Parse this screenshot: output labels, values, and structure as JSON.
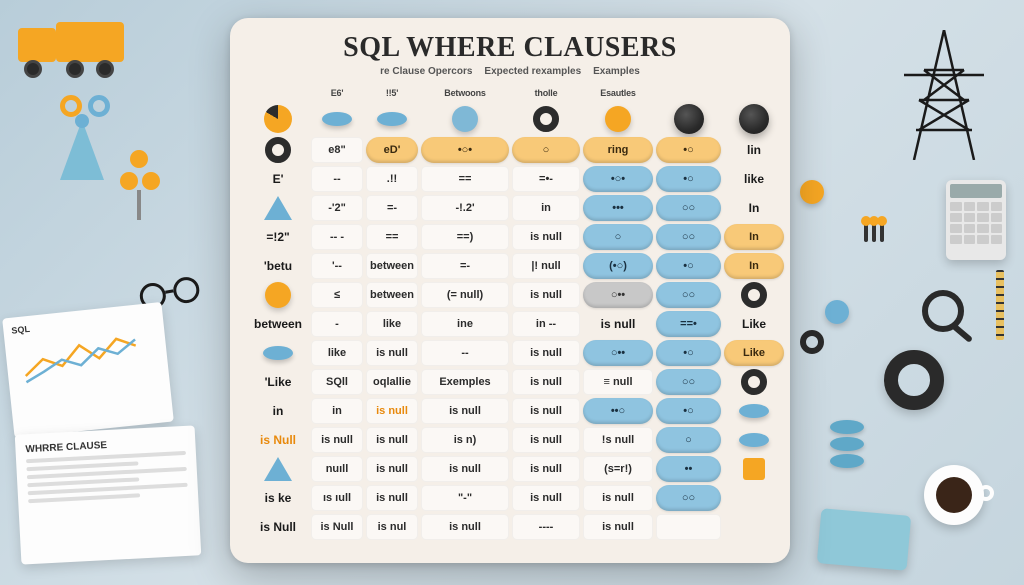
{
  "title": "SQL WHERE CLAUSERS",
  "subheads": [
    "re Clause Opercors",
    "Expected rexamples",
    "Examples"
  ],
  "headers": [
    "",
    "E6'",
    "!!5'",
    "Betwoons",
    "tholle",
    "Esautles",
    "",
    ""
  ],
  "side_labels": [
    "SQL",
    "WHRRE CLAUSE"
  ],
  "paper1_title": "SQL",
  "paper2_title": "WHRRE CLAUSE",
  "rows": [
    {
      "c0": {
        "t": "icon",
        "v": "pie"
      },
      "c1": {
        "t": "icon",
        "v": "disc-b"
      },
      "c2": {
        "t": "icon",
        "v": "disc-b"
      },
      "c3": {
        "t": "icon",
        "v": "circle-b"
      },
      "c4": {
        "t": "icon",
        "v": "ring-dk"
      },
      "c5": {
        "t": "icon",
        "v": "circle-o"
      },
      "c6": {
        "t": "icon",
        "v": "knob"
      },
      "c7": {
        "t": "icon",
        "v": "knob"
      }
    },
    {
      "c0": {
        "t": "icon",
        "v": "ring-dk"
      },
      "c1": {
        "t": "cell",
        "v": "e8\""
      },
      "c2": {
        "t": "pill",
        "v": "eD'"
      },
      "c3": {
        "t": "pill",
        "v": "•○•"
      },
      "c4": {
        "t": "pill",
        "v": "○"
      },
      "c5": {
        "t": "pill",
        "v": "ring"
      },
      "c6": {
        "t": "pill",
        "v": "•○"
      },
      "c7": {
        "t": "text",
        "v": "lin"
      }
    },
    {
      "c0": {
        "t": "text",
        "v": "E'"
      },
      "c1": {
        "t": "cell",
        "v": "--"
      },
      "c2": {
        "t": "cell",
        "v": ".!!"
      },
      "c3": {
        "t": "cell",
        "v": "=="
      },
      "c4": {
        "t": "cell",
        "v": "=•-"
      },
      "c5": {
        "t": "pill-b",
        "v": "•○•"
      },
      "c6": {
        "t": "pill-b",
        "v": "•○"
      },
      "c7": {
        "t": "text",
        "v": "like"
      }
    },
    {
      "c0": {
        "t": "icon",
        "v": "tri-b"
      },
      "c1": {
        "t": "cell",
        "v": "-'2\""
      },
      "c2": {
        "t": "cell",
        "v": "=-"
      },
      "c3": {
        "t": "cell",
        "v": "-!.2'"
      },
      "c4": {
        "t": "cell",
        "v": "in"
      },
      "c5": {
        "t": "pill-b",
        "v": "•••"
      },
      "c6": {
        "t": "pill-b",
        "v": "○○"
      },
      "c7": {
        "t": "text",
        "v": "In"
      }
    },
    {
      "c0": {
        "t": "text",
        "v": "=!2\""
      },
      "c1": {
        "t": "cell",
        "v": "-- -"
      },
      "c2": {
        "t": "cell",
        "v": "=="
      },
      "c3": {
        "t": "cell",
        "v": "==)"
      },
      "c4": {
        "t": "cell",
        "v": "is null"
      },
      "c5": {
        "t": "pill-b",
        "v": "○"
      },
      "c6": {
        "t": "pill-b",
        "v": "○○"
      },
      "c7": {
        "t": "pill",
        "v": "In"
      }
    },
    {
      "c0": {
        "t": "text",
        "v": "'betu"
      },
      "c1": {
        "t": "cell",
        "v": "'--"
      },
      "c2": {
        "t": "cell",
        "v": "between"
      },
      "c3": {
        "t": "cell",
        "v": "=-"
      },
      "c4": {
        "t": "cell",
        "v": "|! null"
      },
      "c5": {
        "t": "pill-b",
        "v": "(•○)"
      },
      "c6": {
        "t": "pill-b",
        "v": "•○"
      },
      "c7": {
        "t": "pill",
        "v": "In"
      }
    },
    {
      "c0": {
        "t": "icon",
        "v": "circle-o"
      },
      "c1": {
        "t": "cell",
        "v": "≤"
      },
      "c2": {
        "t": "cell",
        "v": "between"
      },
      "c3": {
        "t": "cell",
        "v": "(= null)"
      },
      "c4": {
        "t": "cell",
        "v": "is null"
      },
      "c5": {
        "t": "pill-g",
        "v": "○••"
      },
      "c6": {
        "t": "pill-b",
        "v": "○○"
      },
      "c7": {
        "t": "icon",
        "v": "ring-dk"
      }
    },
    {
      "c0": {
        "t": "text",
        "v": "between"
      },
      "c1": {
        "t": "cell",
        "v": "-"
      },
      "c2": {
        "t": "cell",
        "v": "like"
      },
      "c3": {
        "t": "cell",
        "v": "ine"
      },
      "c4": {
        "t": "cell",
        "v": "in --"
      },
      "c5": {
        "t": "text",
        "v": "is null"
      },
      "c6": {
        "t": "pill-b",
        "v": "==•"
      },
      "c7": {
        "t": "text",
        "v": "Like"
      }
    },
    {
      "c0": {
        "t": "icon",
        "v": "disc-b"
      },
      "c1": {
        "t": "cell",
        "v": "like"
      },
      "c2": {
        "t": "cell",
        "v": "is null"
      },
      "c3": {
        "t": "cell",
        "v": "--"
      },
      "c4": {
        "t": "cell",
        "v": "is null"
      },
      "c5": {
        "t": "pill-b",
        "v": "○••"
      },
      "c6": {
        "t": "pill-b",
        "v": "•○"
      },
      "c7": {
        "t": "pill",
        "v": "Like"
      }
    },
    {
      "c0": {
        "t": "text",
        "v": "'Like"
      },
      "c1": {
        "t": "cell",
        "v": "SQll"
      },
      "c2": {
        "t": "cell",
        "v": "oqlallie"
      },
      "c3": {
        "t": "cell",
        "v": "Exemples"
      },
      "c4": {
        "t": "cell",
        "v": "is null"
      },
      "c5": {
        "t": "cell",
        "v": "≡ null"
      },
      "c6": {
        "t": "pill-b",
        "v": "○○"
      },
      "c7": {
        "t": "icon",
        "v": "ring-dk"
      }
    },
    {
      "c0": {
        "t": "text",
        "v": "in"
      },
      "c1": {
        "t": "cell",
        "v": "in"
      },
      "c2": {
        "t": "cell-o",
        "v": "is null"
      },
      "c3": {
        "t": "cell",
        "v": "is null"
      },
      "c4": {
        "t": "cell",
        "v": "is null"
      },
      "c5": {
        "t": "pill-b",
        "v": "••○"
      },
      "c6": {
        "t": "pill-b",
        "v": "•○"
      },
      "c7": {
        "t": "icon",
        "v": "disc-b"
      }
    },
    {
      "c0": {
        "t": "text-o",
        "v": "is Null"
      },
      "c1": {
        "t": "cell",
        "v": "is null"
      },
      "c2": {
        "t": "cell",
        "v": "is null"
      },
      "c3": {
        "t": "cell",
        "v": "is n)"
      },
      "c4": {
        "t": "cell",
        "v": "is null"
      },
      "c5": {
        "t": "cell",
        "v": "!s null"
      },
      "c6": {
        "t": "pill-b",
        "v": "○"
      },
      "c7": {
        "t": "icon",
        "v": "disc-b"
      }
    },
    {
      "c0": {
        "t": "icon",
        "v": "tri-b"
      },
      "c1": {
        "t": "cell",
        "v": "nuıll"
      },
      "c2": {
        "t": "cell",
        "v": "is null"
      },
      "c3": {
        "t": "cell",
        "v": "is null"
      },
      "c4": {
        "t": "cell",
        "v": "is null"
      },
      "c5": {
        "t": "cell",
        "v": "(s=r!)"
      },
      "c6": {
        "t": "pill-b",
        "v": "••"
      },
      "c7": {
        "t": "icon",
        "v": "sq-o"
      }
    },
    {
      "c0": {
        "t": "text",
        "v": "is ke"
      },
      "c1": {
        "t": "cell",
        "v": "ıs ıull"
      },
      "c2": {
        "t": "cell",
        "v": "is null"
      },
      "c3": {
        "t": "cell",
        "v": "\"-\""
      },
      "c4": {
        "t": "cell",
        "v": "is null"
      },
      "c5": {
        "t": "cell",
        "v": "is null"
      },
      "c6": {
        "t": "pill-b",
        "v": "○○"
      },
      "c7": {
        "t": "text",
        "v": ""
      }
    },
    {
      "c0": {
        "t": "text",
        "v": "is Null"
      },
      "c1": {
        "t": "cell",
        "v": "is Null"
      },
      "c2": {
        "t": "cell",
        "v": "is nul"
      },
      "c3": {
        "t": "cell",
        "v": "is null"
      },
      "c4": {
        "t": "cell",
        "v": "----"
      },
      "c5": {
        "t": "cell",
        "v": "is null"
      },
      "c6": {
        "t": "cell",
        "v": ""
      },
      "c7": {
        "t": "text",
        "v": ""
      }
    }
  ]
}
